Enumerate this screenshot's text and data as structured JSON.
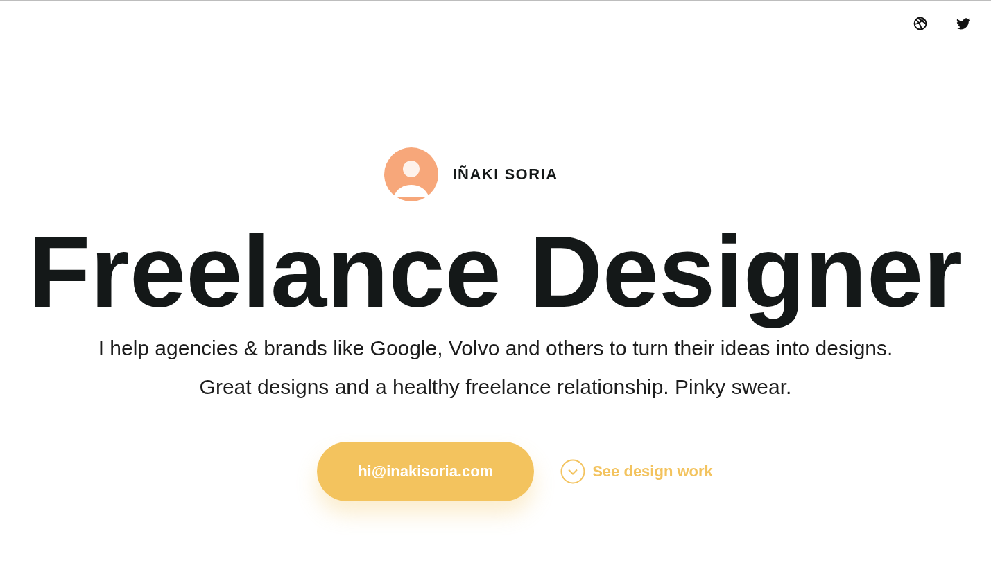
{
  "header": {
    "social_links": [
      {
        "kind": "dribbble"
      },
      {
        "kind": "twitter"
      }
    ]
  },
  "profile": {
    "name": "IÑAKI SORIA"
  },
  "hero": {
    "title": "Freelance Designer",
    "lines": [
      "I help agencies & brands like Google, Volvo and others to turn their ideas into designs.",
      "Great designs and a healthy freelance relationship. Pinky swear."
    ],
    "email_button": "hi@inakisoria.com",
    "work_link": "See design work"
  }
}
